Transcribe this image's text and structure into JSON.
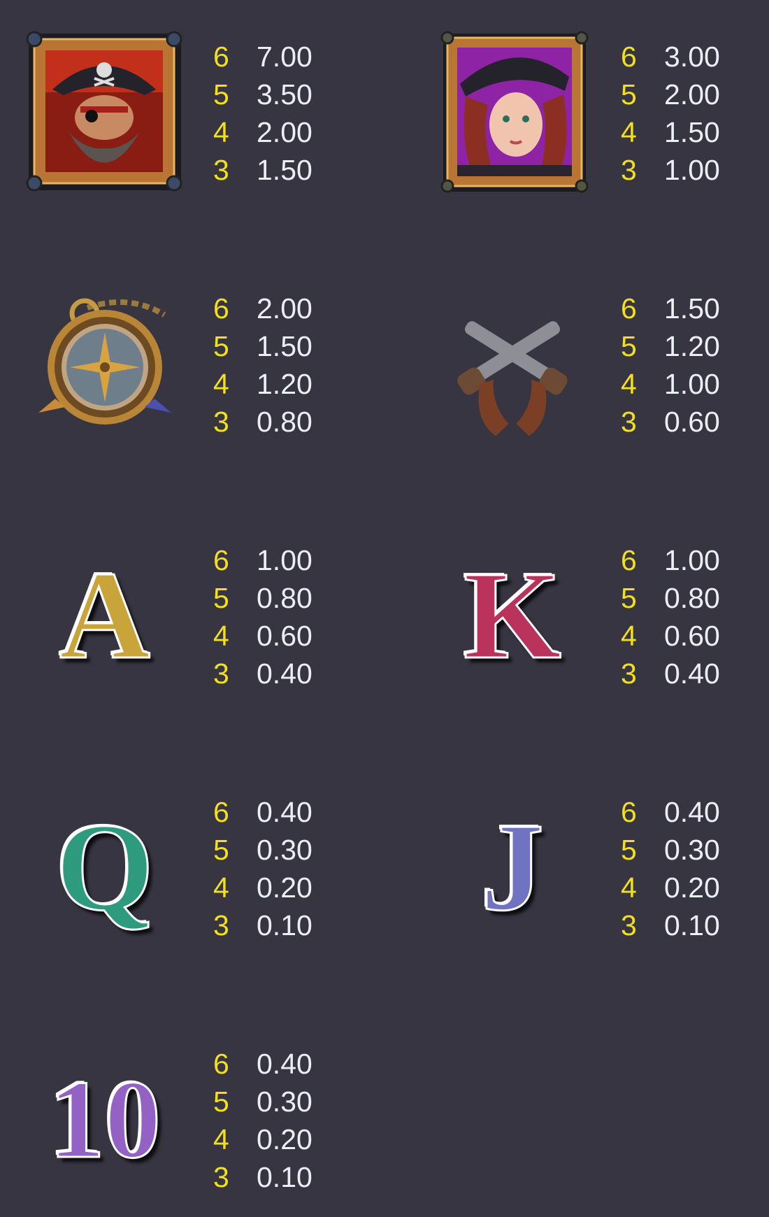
{
  "paytable": [
    {
      "symbol": "pirate-captain",
      "pays": [
        {
          "count": "6",
          "value": "7.00"
        },
        {
          "count": "5",
          "value": "3.50"
        },
        {
          "count": "4",
          "value": "2.00"
        },
        {
          "count": "3",
          "value": "1.50"
        }
      ]
    },
    {
      "symbol": "pirate-lady",
      "pays": [
        {
          "count": "6",
          "value": "3.00"
        },
        {
          "count": "5",
          "value": "2.00"
        },
        {
          "count": "4",
          "value": "1.50"
        },
        {
          "count": "3",
          "value": "1.00"
        }
      ]
    },
    {
      "symbol": "compass",
      "pays": [
        {
          "count": "6",
          "value": "2.00"
        },
        {
          "count": "5",
          "value": "1.50"
        },
        {
          "count": "4",
          "value": "1.20"
        },
        {
          "count": "3",
          "value": "0.80"
        }
      ]
    },
    {
      "symbol": "crossed-pistols",
      "pays": [
        {
          "count": "6",
          "value": "1.50"
        },
        {
          "count": "5",
          "value": "1.20"
        },
        {
          "count": "4",
          "value": "1.00"
        },
        {
          "count": "3",
          "value": "0.60"
        }
      ]
    },
    {
      "symbol": "A",
      "letter": "A",
      "color": "#c9a43a",
      "pays": [
        {
          "count": "6",
          "value": "1.00"
        },
        {
          "count": "5",
          "value": "0.80"
        },
        {
          "count": "4",
          "value": "0.60"
        },
        {
          "count": "3",
          "value": "0.40"
        }
      ]
    },
    {
      "symbol": "K",
      "letter": "K",
      "color": "#b9335c",
      "pays": [
        {
          "count": "6",
          "value": "1.00"
        },
        {
          "count": "5",
          "value": "0.80"
        },
        {
          "count": "4",
          "value": "0.60"
        },
        {
          "count": "3",
          "value": "0.40"
        }
      ]
    },
    {
      "symbol": "Q",
      "letter": "Q",
      "color": "#2f9b7e",
      "pays": [
        {
          "count": "6",
          "value": "0.40"
        },
        {
          "count": "5",
          "value": "0.30"
        },
        {
          "count": "4",
          "value": "0.20"
        },
        {
          "count": "3",
          "value": "0.10"
        }
      ]
    },
    {
      "symbol": "J",
      "letter": "J",
      "color": "#6f73c2",
      "pays": [
        {
          "count": "6",
          "value": "0.40"
        },
        {
          "count": "5",
          "value": "0.30"
        },
        {
          "count": "4",
          "value": "0.20"
        },
        {
          "count": "3",
          "value": "0.10"
        }
      ]
    },
    {
      "symbol": "10",
      "letter": "10",
      "color": "#9362c4",
      "pays": [
        {
          "count": "6",
          "value": "0.40"
        },
        {
          "count": "5",
          "value": "0.30"
        },
        {
          "count": "4",
          "value": "0.20"
        },
        {
          "count": "3",
          "value": "0.10"
        }
      ]
    }
  ],
  "colors": {
    "background": "#363541",
    "count": "#f3df1a",
    "value": "#eceef5"
  }
}
